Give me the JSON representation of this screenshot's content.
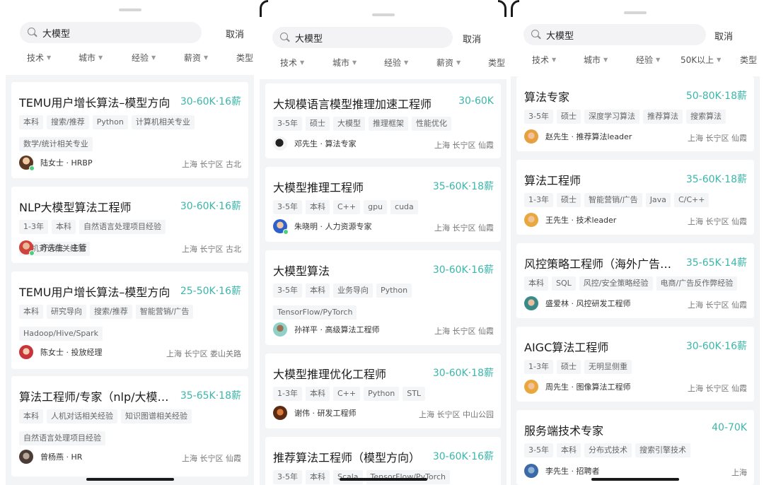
{
  "colors": {
    "accent": "#3cb6aa",
    "online": "#4cd080",
    "page_bg": "#f3f4f6"
  },
  "panels": [
    {
      "search": {
        "query": "大模型",
        "cancel": "取消"
      },
      "filters": [
        "技术",
        "城市",
        "经验",
        "薪资",
        "类型"
      ],
      "jobs": [
        {
          "title": "TEMU用户增长算法–模型方向",
          "salary": "30-60K·16薪",
          "tags": [
            "本科",
            "搜索/推荐",
            "Python",
            "计算机相关专业",
            "数学/统计相关专业"
          ],
          "poster": "陆女士 · HRBP",
          "location": "上海 长宁区 古北",
          "online": true
        },
        {
          "title": "NLP大模型算法工程师",
          "salary": "30-60K·16薪",
          "tags": [
            "1-3年",
            "本科",
            "自然语言处理项目经验",
            "人机对话相关经验"
          ],
          "poster": "齐先生 · 主管",
          "location": "上海 长宁区 古北",
          "online": true
        },
        {
          "title": "TEMU用户增长算法–模型方向",
          "salary": "25-50K·16薪",
          "tags": [
            "本科",
            "研究导向",
            "搜索/推荐",
            "智能营销/广告",
            "Hadoop/Hive/Spark"
          ],
          "poster": "陈女士 · 投放经理",
          "location": "上海 长宁区 娄山关路",
          "online": false
        },
        {
          "title": "算法工程师/专家（nlp/大模…",
          "salary": "35-65K·18薪",
          "tags": [
            "本科",
            "人机对话相关经验",
            "知识图谱相关经验",
            "自然语言处理项目经验"
          ],
          "poster": "曾杨燕 · HR",
          "location": "上海 长宁区 仙霞",
          "online": false
        }
      ]
    },
    {
      "search": {
        "query": "大模型",
        "cancel": "取消"
      },
      "filters": [
        "技术",
        "城市",
        "经验",
        "薪资",
        "类型"
      ],
      "jobs": [
        {
          "title": "大规模语言模型推理加速工程师",
          "salary": "30-60K",
          "tags": [
            "3-5年",
            "硕士",
            "大模型",
            "推理框架",
            "性能优化"
          ],
          "poster": "邓先生 · 算法专家",
          "location": "上海 长宁区 仙霞",
          "online": false
        },
        {
          "title": "大模型推理工程师",
          "salary": "35-60K·18薪",
          "tags": [
            "3-5年",
            "本科",
            "C++",
            "gpu",
            "cuda"
          ],
          "poster": "朱晓明 · 人力资源专家",
          "location": "上海 长宁区 仙霞",
          "online": true
        },
        {
          "title": "大模型算法",
          "salary": "30-60K·16薪",
          "tags": [
            "3-5年",
            "本科",
            "业务导向",
            "Python",
            "TensorFlow/PyTorch"
          ],
          "poster": "孙祥平 · 高级算法工程师",
          "location": "上海 长宁区 仙霞",
          "online": false
        },
        {
          "title": "大模型推理优化工程师",
          "salary": "30-60K·18薪",
          "tags": [
            "1-3年",
            "本科",
            "C++",
            "Python",
            "STL"
          ],
          "poster": "谢伟 · 研发工程师",
          "location": "上海 长宁区 中山公园",
          "online": false
        },
        {
          "title": "推荐算法工程师（模型方向）",
          "salary": "30-60K·16薪",
          "tags": [
            "3-5年",
            "本科",
            "Scala",
            "TensorFlow/PyTorch"
          ],
          "poster": "",
          "location": "",
          "online": false
        }
      ]
    },
    {
      "search": {
        "query": "大模型",
        "cancel": "取消"
      },
      "filters": [
        "技术",
        "城市",
        "经验",
        "50K以上",
        "类型"
      ],
      "jobs": [
        {
          "title": "算法专家",
          "salary": "50-80K·18薪",
          "tags": [
            "3-5年",
            "硕士",
            "深度学习算法",
            "推荐算法",
            "搜索算法"
          ],
          "poster": "赵先生 · 推荐算法leader",
          "location": "上海 长宁区 仙霞",
          "online": false
        },
        {
          "title": "算法工程师",
          "salary": "35-60K·18薪",
          "tags": [
            "1-3年",
            "硕士",
            "智能营销/广告",
            "Java",
            "C/C++"
          ],
          "poster": "王先生 · 技术leader",
          "location": "上海 长宁区 仙霞",
          "online": false
        },
        {
          "title": "风控策略工程师（海外广告…",
          "salary": "35-65K·14薪",
          "tags": [
            "本科",
            "SQL",
            "风控/安全策略经验",
            "电商/广告反作弊经验"
          ],
          "poster": "盛爱林 · 风控研发工程师",
          "location": "上海 长宁区 仙霞",
          "online": false
        },
        {
          "title": "AIGC算法工程师",
          "salary": "30-60K·16薪",
          "tags": [
            "1-3年",
            "硕士",
            "无明显侧重"
          ],
          "poster": "周先生 · 图像算法工程师",
          "location": "上海 长宁区 仙霞",
          "online": false
        },
        {
          "title": "服务端技术专家",
          "salary": "40-70K",
          "tags": [
            "3-5年",
            "本科",
            "分布式技术",
            "搜索引擎技术"
          ],
          "poster": "李先生 · 招聘者",
          "location": "上海",
          "online": false
        }
      ]
    }
  ]
}
